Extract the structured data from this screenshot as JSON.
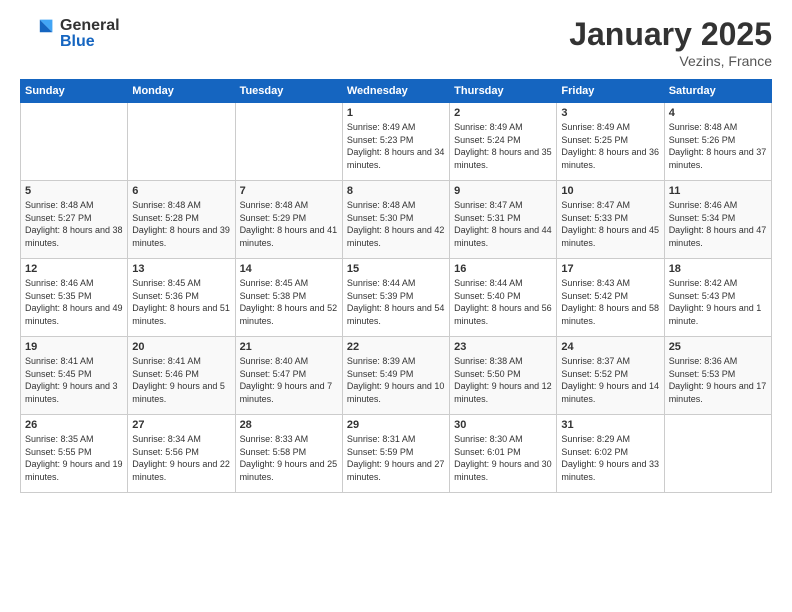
{
  "logo": {
    "general": "General",
    "blue": "Blue"
  },
  "title": "January 2025",
  "location": "Vezins, France",
  "days_header": [
    "Sunday",
    "Monday",
    "Tuesday",
    "Wednesday",
    "Thursday",
    "Friday",
    "Saturday"
  ],
  "weeks": [
    [
      {
        "day": "",
        "content": ""
      },
      {
        "day": "",
        "content": ""
      },
      {
        "day": "",
        "content": ""
      },
      {
        "day": "1",
        "content": "Sunrise: 8:49 AM\nSunset: 5:23 PM\nDaylight: 8 hours and 34 minutes."
      },
      {
        "day": "2",
        "content": "Sunrise: 8:49 AM\nSunset: 5:24 PM\nDaylight: 8 hours and 35 minutes."
      },
      {
        "day": "3",
        "content": "Sunrise: 8:49 AM\nSunset: 5:25 PM\nDaylight: 8 hours and 36 minutes."
      },
      {
        "day": "4",
        "content": "Sunrise: 8:48 AM\nSunset: 5:26 PM\nDaylight: 8 hours and 37 minutes."
      }
    ],
    [
      {
        "day": "5",
        "content": "Sunrise: 8:48 AM\nSunset: 5:27 PM\nDaylight: 8 hours and 38 minutes."
      },
      {
        "day": "6",
        "content": "Sunrise: 8:48 AM\nSunset: 5:28 PM\nDaylight: 8 hours and 39 minutes."
      },
      {
        "day": "7",
        "content": "Sunrise: 8:48 AM\nSunset: 5:29 PM\nDaylight: 8 hours and 41 minutes."
      },
      {
        "day": "8",
        "content": "Sunrise: 8:48 AM\nSunset: 5:30 PM\nDaylight: 8 hours and 42 minutes."
      },
      {
        "day": "9",
        "content": "Sunrise: 8:47 AM\nSunset: 5:31 PM\nDaylight: 8 hours and 44 minutes."
      },
      {
        "day": "10",
        "content": "Sunrise: 8:47 AM\nSunset: 5:33 PM\nDaylight: 8 hours and 45 minutes."
      },
      {
        "day": "11",
        "content": "Sunrise: 8:46 AM\nSunset: 5:34 PM\nDaylight: 8 hours and 47 minutes."
      }
    ],
    [
      {
        "day": "12",
        "content": "Sunrise: 8:46 AM\nSunset: 5:35 PM\nDaylight: 8 hours and 49 minutes."
      },
      {
        "day": "13",
        "content": "Sunrise: 8:45 AM\nSunset: 5:36 PM\nDaylight: 8 hours and 51 minutes."
      },
      {
        "day": "14",
        "content": "Sunrise: 8:45 AM\nSunset: 5:38 PM\nDaylight: 8 hours and 52 minutes."
      },
      {
        "day": "15",
        "content": "Sunrise: 8:44 AM\nSunset: 5:39 PM\nDaylight: 8 hours and 54 minutes."
      },
      {
        "day": "16",
        "content": "Sunrise: 8:44 AM\nSunset: 5:40 PM\nDaylight: 8 hours and 56 minutes."
      },
      {
        "day": "17",
        "content": "Sunrise: 8:43 AM\nSunset: 5:42 PM\nDaylight: 8 hours and 58 minutes."
      },
      {
        "day": "18",
        "content": "Sunrise: 8:42 AM\nSunset: 5:43 PM\nDaylight: 9 hours and 1 minute."
      }
    ],
    [
      {
        "day": "19",
        "content": "Sunrise: 8:41 AM\nSunset: 5:45 PM\nDaylight: 9 hours and 3 minutes."
      },
      {
        "day": "20",
        "content": "Sunrise: 8:41 AM\nSunset: 5:46 PM\nDaylight: 9 hours and 5 minutes."
      },
      {
        "day": "21",
        "content": "Sunrise: 8:40 AM\nSunset: 5:47 PM\nDaylight: 9 hours and 7 minutes."
      },
      {
        "day": "22",
        "content": "Sunrise: 8:39 AM\nSunset: 5:49 PM\nDaylight: 9 hours and 10 minutes."
      },
      {
        "day": "23",
        "content": "Sunrise: 8:38 AM\nSunset: 5:50 PM\nDaylight: 9 hours and 12 minutes."
      },
      {
        "day": "24",
        "content": "Sunrise: 8:37 AM\nSunset: 5:52 PM\nDaylight: 9 hours and 14 minutes."
      },
      {
        "day": "25",
        "content": "Sunrise: 8:36 AM\nSunset: 5:53 PM\nDaylight: 9 hours and 17 minutes."
      }
    ],
    [
      {
        "day": "26",
        "content": "Sunrise: 8:35 AM\nSunset: 5:55 PM\nDaylight: 9 hours and 19 minutes."
      },
      {
        "day": "27",
        "content": "Sunrise: 8:34 AM\nSunset: 5:56 PM\nDaylight: 9 hours and 22 minutes."
      },
      {
        "day": "28",
        "content": "Sunrise: 8:33 AM\nSunset: 5:58 PM\nDaylight: 9 hours and 25 minutes."
      },
      {
        "day": "29",
        "content": "Sunrise: 8:31 AM\nSunset: 5:59 PM\nDaylight: 9 hours and 27 minutes."
      },
      {
        "day": "30",
        "content": "Sunrise: 8:30 AM\nSunset: 6:01 PM\nDaylight: 9 hours and 30 minutes."
      },
      {
        "day": "31",
        "content": "Sunrise: 8:29 AM\nSunset: 6:02 PM\nDaylight: 9 hours and 33 minutes."
      },
      {
        "day": "",
        "content": ""
      }
    ]
  ]
}
